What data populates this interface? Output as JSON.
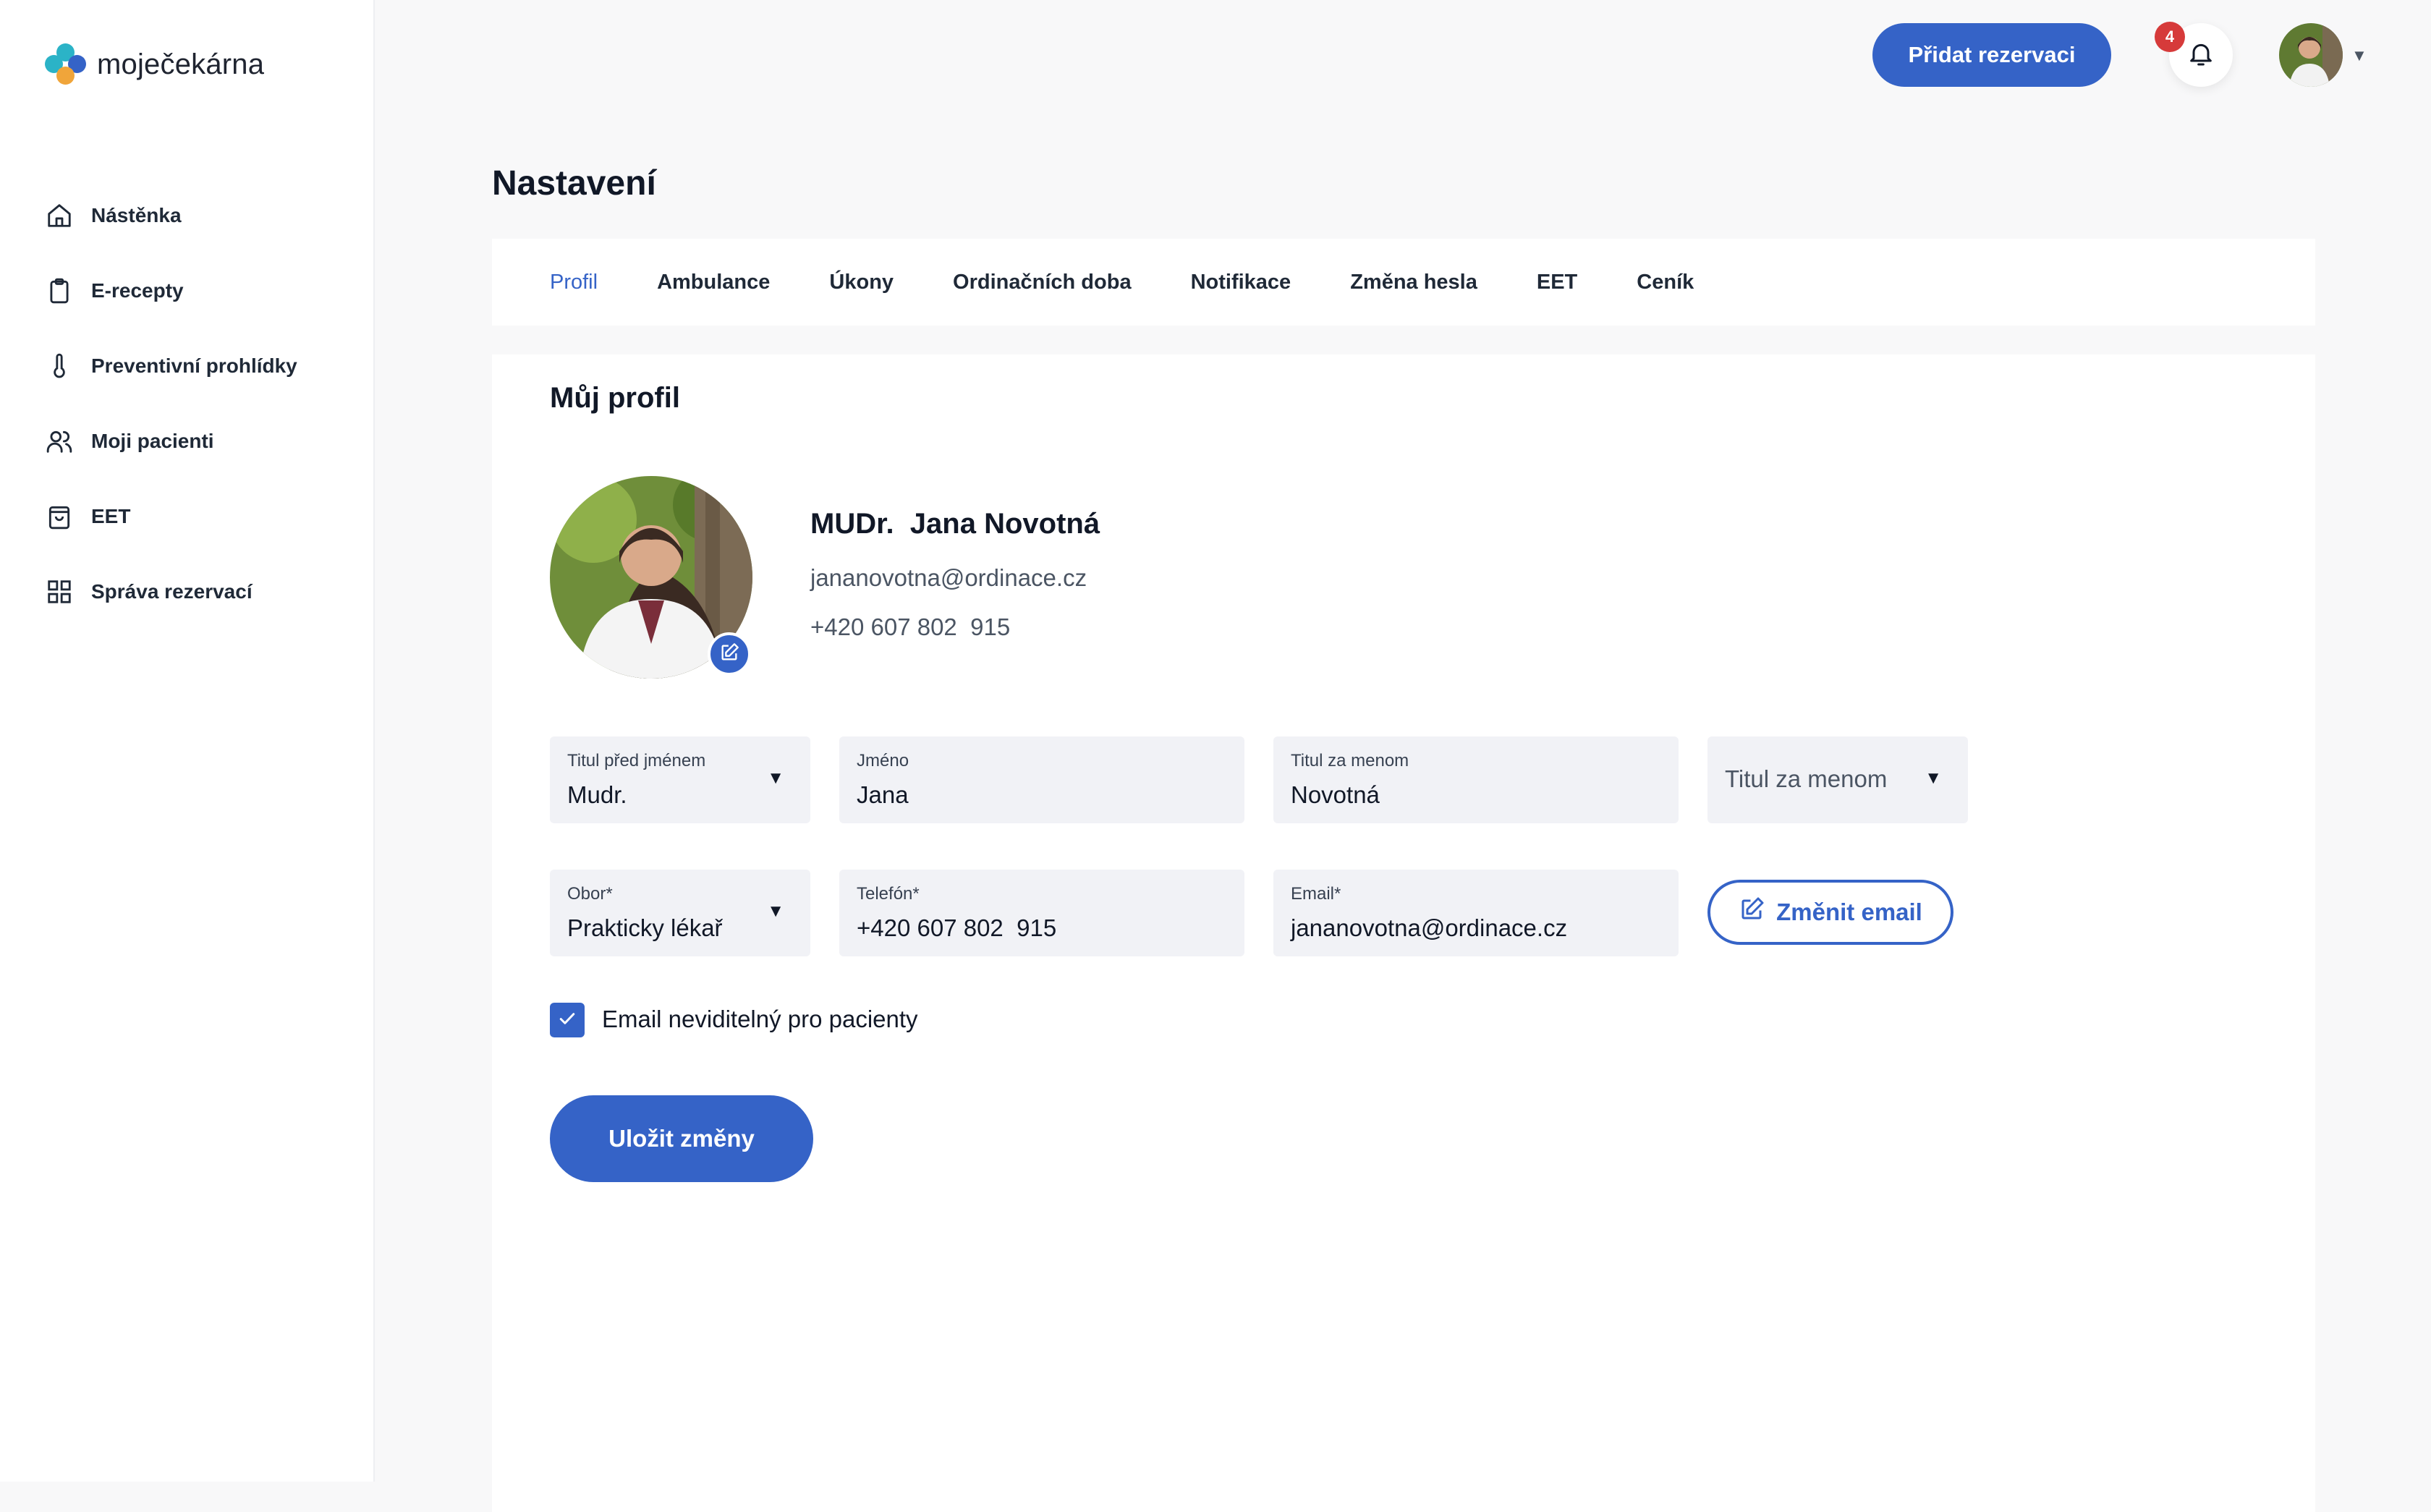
{
  "app": {
    "logo_text": "moječekárna",
    "colors": {
      "primary": "#3563c7",
      "badge": "#d63a3a",
      "logo_teal": "#2bb3c7",
      "logo_blue": "#3563c7",
      "logo_orange": "#f0a53a"
    }
  },
  "sidebar": {
    "items": [
      {
        "label": "Nástěnka",
        "icon": "home-icon"
      },
      {
        "label": "E-recepty",
        "icon": "clipboard-icon"
      },
      {
        "label": "Preventivní prohlídky",
        "icon": "thermometer-icon"
      },
      {
        "label": "Moji pacienti",
        "icon": "users-icon"
      },
      {
        "label": "EET",
        "icon": "shopping-bag-icon"
      },
      {
        "label": "Správa rezervací",
        "icon": "grid-icon"
      }
    ]
  },
  "topbar": {
    "add_reservation_label": "Přidat rezervaci",
    "notification_count": "4"
  },
  "page": {
    "title": "Nastavení",
    "tabs": [
      {
        "label": "Profil",
        "active": true
      },
      {
        "label": "Ambulance"
      },
      {
        "label": "Úkony"
      },
      {
        "label": "Ordinačních doba"
      },
      {
        "label": "Notifikace"
      },
      {
        "label": "Změna hesla"
      },
      {
        "label": "EET"
      },
      {
        "label": "Ceník"
      }
    ]
  },
  "profile": {
    "section_title": "Můj profil",
    "name": "MUDr.  Jana Novotná",
    "email": "jananovotna@ordinace.cz",
    "phone": "+420 607 802  915"
  },
  "form": {
    "title_before": {
      "label": "Titul před jménem",
      "value": "Mudr."
    },
    "first_name": {
      "label": "Jméno",
      "value": "Jana"
    },
    "title_after_text": {
      "label": "Titul za menom",
      "value": "Novotná"
    },
    "title_after_select": {
      "placeholder": "Titul za menom"
    },
    "specialty": {
      "label": "Obor*",
      "value": "Prakticky lékař"
    },
    "phone": {
      "label": "Telefón*",
      "value": "+420 607 802  915"
    },
    "email": {
      "label": "Email*",
      "value": "jananovotna@ordinace.cz"
    },
    "change_email_label": "Změnit email",
    "email_hidden_label": "Email neviditelný pro pacienty",
    "email_hidden_checked": true,
    "save_label": "Uložit změny"
  }
}
